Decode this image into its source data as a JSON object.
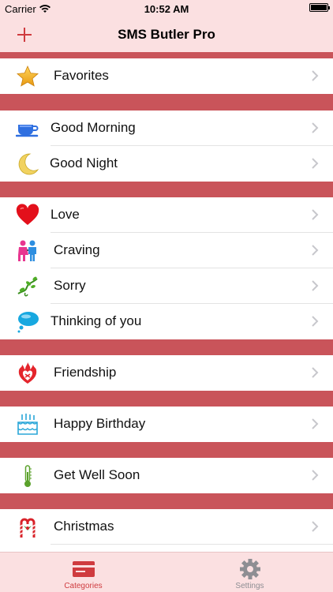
{
  "status_bar": {
    "carrier": "Carrier",
    "time": "10:52 AM",
    "battery_level": 1.0
  },
  "nav": {
    "title": "SMS Butler Pro",
    "add_icon": "plus-icon"
  },
  "colors": {
    "accent": "#cf3b3f",
    "section_separator": "#c9545a",
    "bar_background": "#fbe0e1"
  },
  "categories": [
    {
      "label": "Favorites",
      "icon": "star-icon"
    },
    {
      "label": "Good Morning",
      "icon": "teacup-icon"
    },
    {
      "label": "Good Night",
      "icon": "moon-icon"
    },
    {
      "label": "Love",
      "icon": "heart-icon"
    },
    {
      "label": "Craving",
      "icon": "couple-icon"
    },
    {
      "label": "Sorry",
      "icon": "vine-icon"
    },
    {
      "label": "Thinking of you",
      "icon": "speech-bubble-icon"
    },
    {
      "label": "Friendship",
      "icon": "flame-heart-icon"
    },
    {
      "label": "Happy Birthday",
      "icon": "cake-icon"
    },
    {
      "label": "Get Well Soon",
      "icon": "thermometer-icon"
    },
    {
      "label": "Christmas",
      "icon": "candy-cane-icon"
    }
  ],
  "tabs": [
    {
      "label": "Categories",
      "icon": "card-icon",
      "selected": true
    },
    {
      "label": "Settings",
      "icon": "gear-icon",
      "selected": false
    }
  ]
}
